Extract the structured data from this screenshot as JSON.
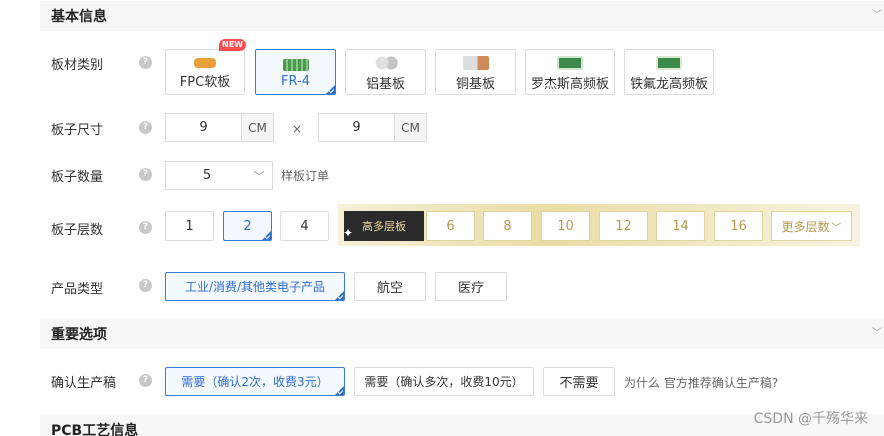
{
  "sections": {
    "basic": "基本信息",
    "important": "重要选项",
    "pcb": "PCB工艺信息"
  },
  "help_icon": "?",
  "labels": {
    "material": "板材类别",
    "size": "板子尺寸",
    "quantity": "板子数量",
    "layers": "板子层数",
    "product_type": "产品类型",
    "confirm": "确认生产稿"
  },
  "materials": [
    {
      "label": "FPC软板",
      "icon": "fpc-board-icon",
      "color": "#e9a13b",
      "badge": "NEW"
    },
    {
      "label": "FR-4",
      "icon": "fr4-board-icon",
      "color": "#4a9a4a",
      "selected": true
    },
    {
      "label": "铝基板",
      "icon": "aluminum-board-icon",
      "color": "#c9c9c9"
    },
    {
      "label": "铜基板",
      "icon": "copper-board-icon",
      "color": "#d08a5a"
    },
    {
      "label": "罗杰斯高频板",
      "icon": "rogers-board-icon",
      "color": "#3c8a4a"
    },
    {
      "label": "铁氟龙高频板",
      "icon": "teflon-board-icon",
      "color": "#3c8a4a"
    }
  ],
  "size": {
    "width": "9",
    "height": "9",
    "unit": "CM",
    "times": "×"
  },
  "quantity": {
    "value": "5",
    "hint": "样板订单"
  },
  "layers": {
    "basic": [
      {
        "label": "1"
      },
      {
        "label": "2",
        "selected": true
      },
      {
        "label": "4"
      }
    ],
    "multi_label": "高多层板",
    "multi": [
      "6",
      "8",
      "10",
      "12",
      "14",
      "16"
    ],
    "more": "更多层数"
  },
  "product_types": [
    {
      "label": "工业/消费/其他类电子产品",
      "selected": true
    },
    {
      "label": "航空"
    },
    {
      "label": "医疗"
    }
  ],
  "confirm_options": [
    {
      "label": "需要（确认2次，收费3元）",
      "selected": true
    },
    {
      "label": "需要（确认多次，收费10元）"
    },
    {
      "label": "不需要"
    }
  ],
  "confirm_hint": "为什么 官方推荐确认生产稿?",
  "watermark": "CSDN @千殇华来",
  "colors": {
    "accent": "#2f6fd0",
    "gold": "#b59a4e",
    "dark": "#2b2b2b"
  }
}
